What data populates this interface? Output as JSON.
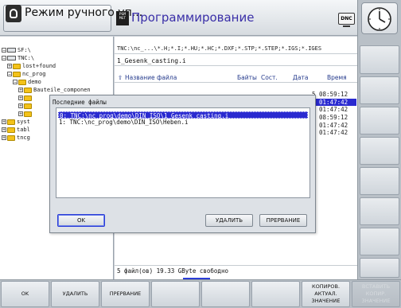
{
  "header": {
    "mode_label": "Режим ручного уп...",
    "prog_icon_text": "PGM MGT",
    "prog_label": "Программирование",
    "dnc_label": "DNC"
  },
  "tree": {
    "items": [
      {
        "label": "SF:\\",
        "exp": "⊟",
        "kind": "drive",
        "indent": 0
      },
      {
        "label": "TNC:\\",
        "exp": "⊟",
        "kind": "drive",
        "indent": 0
      },
      {
        "label": "lost+found",
        "exp": "⊞",
        "kind": "folder",
        "indent": 1
      },
      {
        "label": "nc_prog",
        "exp": "⊟",
        "kind": "folder",
        "indent": 1
      },
      {
        "label": "demo",
        "exp": "⊟",
        "kind": "folder",
        "indent": 2
      },
      {
        "label": "Bauteile_componen",
        "exp": "⊞",
        "kind": "folder",
        "indent": 3
      },
      {
        "label": "",
        "exp": "⊞",
        "kind": "folder",
        "indent": 3
      },
      {
        "label": "",
        "exp": "⊞",
        "kind": "folder",
        "indent": 3
      },
      {
        "label": "",
        "exp": "⊞",
        "kind": "folder",
        "indent": 3
      },
      {
        "label": "syst",
        "exp": "⊞",
        "kind": "folder",
        "indent": 0
      },
      {
        "label": "tabl",
        "exp": "⊞",
        "kind": "folder",
        "indent": 0
      },
      {
        "label": "tncg",
        "exp": "⊞",
        "kind": "folder",
        "indent": 0
      }
    ]
  },
  "files": {
    "path": "TNC:\\nc_...\\*.H;*.I;*.HU;*.HC;*.DXF;*.STP;*.STEP;*.IGS;*.IGES",
    "current_file": "1_Gesenk_casting.i",
    "columns": {
      "name": "Название файла",
      "bytes": "Байты",
      "state": "Сост.",
      "date": "Дата",
      "time": "Время"
    },
    "times": [
      "5 08:59:12",
      "5 01:47:42",
      "5 01:47:42",
      "5 08:59:12",
      "5 01:47:42",
      "5 01:47:42"
    ],
    "selected_time_index": 1,
    "status": "5   файл(ов)   19.33 GByte свободно"
  },
  "dialog": {
    "title": "Последние файлы",
    "items": [
      "0: TNC:\\nc_prog\\demo\\DIN_ISO\\1_Gesenk_casting.i",
      "1: TNC:\\nc_prog\\demo\\DIN_ISO\\Heben.i"
    ],
    "selected_index": 0,
    "ok_label": "OK",
    "delete_label": "УДАЛИТЬ",
    "abort_label": "ПРЕРВАНИЕ"
  },
  "softkeys": [
    {
      "label": "OK",
      "disabled": false
    },
    {
      "label": "УДАЛИТЬ",
      "disabled": false
    },
    {
      "label": "ПРЕРВАНИЕ",
      "disabled": false
    },
    {
      "label": "",
      "disabled": false
    },
    {
      "label": "",
      "disabled": false
    },
    {
      "label": "",
      "disabled": false
    },
    {
      "label": "КОПИРОВ.\nАКТУАЛ.\nЗНАЧЕНИЕ",
      "disabled": false
    },
    {
      "label": "ВСТАВИТЬ\nКОПИР.\nЗНАЧЕНИЕ",
      "disabled": true
    }
  ],
  "colors": {
    "selection": "#2a2ad0",
    "prog_title": "#3a2fa8",
    "column_header": "#243a8c"
  }
}
